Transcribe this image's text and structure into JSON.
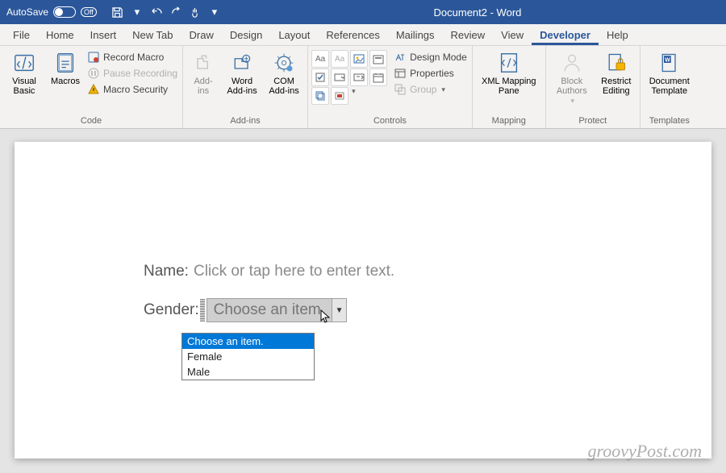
{
  "titlebar": {
    "autosave_label": "AutoSave",
    "autosave_state": "Off",
    "document_title": "Document2 - Word"
  },
  "menus": [
    "File",
    "Home",
    "Insert",
    "New Tab",
    "Draw",
    "Design",
    "Layout",
    "References",
    "Mailings",
    "Review",
    "View",
    "Developer",
    "Help"
  ],
  "active_menu": "Developer",
  "ribbon": {
    "code": {
      "visual_basic": "Visual\nBasic",
      "macros": "Macros",
      "record_macro": "Record Macro",
      "pause_recording": "Pause Recording",
      "macro_security": "Macro Security",
      "group_label": "Code"
    },
    "addins": {
      "addins": "Add-\nins",
      "word_addins": "Word\nAdd-ins",
      "com_addins": "COM\nAdd-ins",
      "group_label": "Add-ins"
    },
    "controls": {
      "design_mode": "Design Mode",
      "properties": "Properties",
      "group": "Group",
      "group_label": "Controls"
    },
    "mapping": {
      "label": "XML Mapping\nPane",
      "group_label": "Mapping"
    },
    "protect": {
      "block_authors": "Block\nAuthors",
      "restrict_editing": "Restrict\nEditing",
      "group_label": "Protect"
    },
    "templates": {
      "label": "Document\nTemplate",
      "group_label": "Templates"
    }
  },
  "form": {
    "name_label": "Name:",
    "name_placeholder": "Click or tap here to enter text.",
    "gender_label": "Gender:",
    "gender_value": "Choose an item.",
    "options": [
      "Choose an item.",
      "Female",
      "Male"
    ]
  },
  "watermark": "groovyPost.com"
}
